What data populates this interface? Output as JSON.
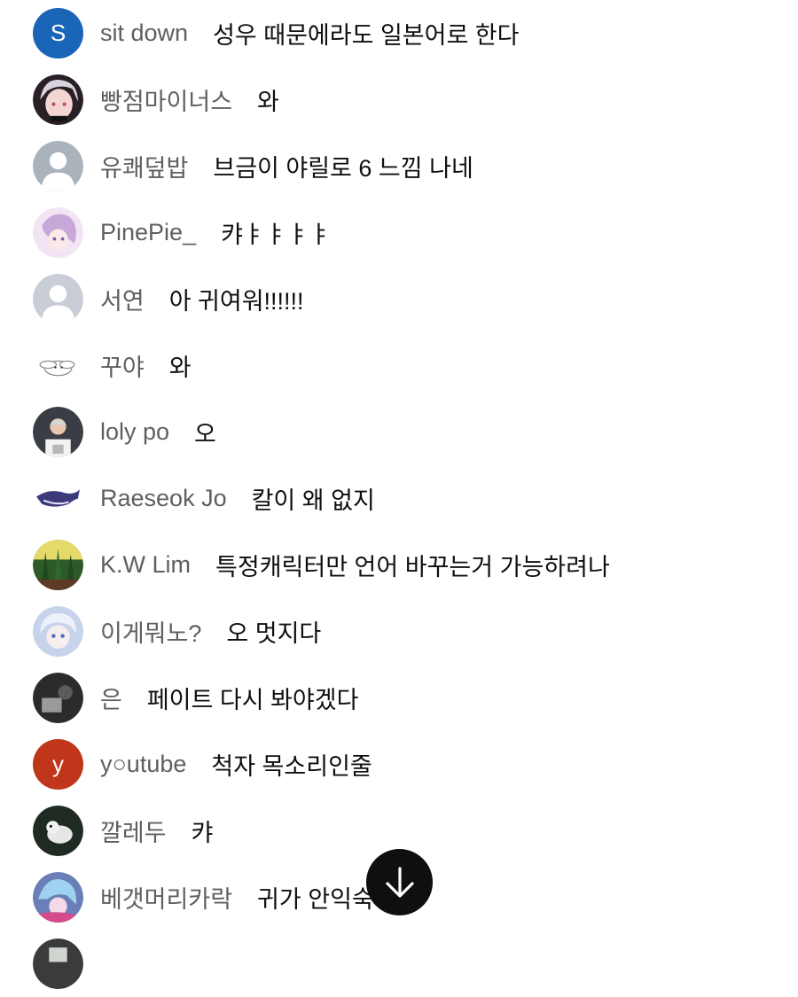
{
  "chat": {
    "messages": [
      {
        "author": "sit down",
        "text": "성우 때문에라도 일본어로 한다",
        "avatar": {
          "kind": "letter",
          "letter": "S",
          "color": "#1a65b7"
        }
      },
      {
        "author": "빵점마이너스",
        "text": "와",
        "avatar": {
          "kind": "image",
          "color": "#2a1f26"
        }
      },
      {
        "author": "유쾌덮밥",
        "text": "브금이 야릴로 6 느낌 나네",
        "avatar": {
          "kind": "default",
          "color": "#aab2bb"
        }
      },
      {
        "author": "PinePie_",
        "text": "캬ㅑㅑㅑㅑ",
        "avatar": {
          "kind": "image",
          "color": "#e6d4ea"
        }
      },
      {
        "author": "서연",
        "text": "아 귀여워!!!!!!",
        "avatar": {
          "kind": "default",
          "color": "#c9ced6"
        }
      },
      {
        "author": "꾸야",
        "text": "와",
        "avatar": {
          "kind": "image",
          "color": "#ffffff"
        }
      },
      {
        "author": "loly po",
        "text": "오",
        "avatar": {
          "kind": "image",
          "color": "#3a3d44"
        }
      },
      {
        "author": "Raeseok Jo",
        "text": "칼이 왜 없지",
        "avatar": {
          "kind": "image",
          "color": "#ffffff"
        }
      },
      {
        "author": "K.W Lim",
        "text": "특정캐릭터만 언어 바꾸는거 가능하려나",
        "avatar": {
          "kind": "image",
          "color": "#2e5a2a"
        }
      },
      {
        "author": "이게뭐노?",
        "text": "오 멋지다",
        "avatar": {
          "kind": "image",
          "color": "#c7d3ea"
        }
      },
      {
        "author": "은",
        "text": "페이트 다시 봐야겠다",
        "avatar": {
          "kind": "image",
          "color": "#2b2b2b"
        }
      },
      {
        "author": "y○utube",
        "text": "척자 목소리인줄",
        "avatar": {
          "kind": "letter",
          "letter": "y",
          "color": "#c0361a"
        }
      },
      {
        "author": "깔레두",
        "text": "캬",
        "avatar": {
          "kind": "image",
          "color": "#1f2a22"
        }
      },
      {
        "author": "베갯머리카락",
        "text": "귀가 안익숙해;;;",
        "avatar": {
          "kind": "image",
          "color": "#6a7fb8"
        }
      },
      {
        "author": "",
        "text": "",
        "avatar": {
          "kind": "image",
          "color": "#3b3b3b"
        }
      }
    ]
  },
  "scroll_down_button": {
    "icon": "arrow-down-icon"
  },
  "colors": {
    "author_text": "#5f5f5f",
    "message_text": "#0f0f0f",
    "background": "#ffffff",
    "fab_background": "#0f0f0f"
  }
}
